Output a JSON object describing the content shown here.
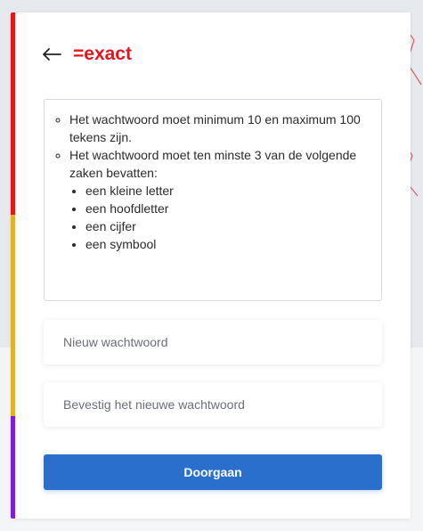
{
  "header": {
    "back_icon": "arrow-left-icon",
    "logo_text": "=exact",
    "logo_color": "#e8141c"
  },
  "rules": {
    "items": [
      "Het wachtwoord moet minimum 10 en maximum 100 tekens zijn.",
      "Het wachtwoord moet ten minste 3 van de volgende zaken bevatten:"
    ],
    "subitems": [
      "een kleine letter",
      "een hoofdletter",
      "een cijfer",
      "een symbool"
    ]
  },
  "form": {
    "new_password_placeholder": "Nieuw wachtwoord",
    "confirm_password_placeholder": "Bevestig het nieuwe wachtwoord",
    "submit_label": "Doorgaan"
  },
  "colors": {
    "stripe_red": "#e8141c",
    "stripe_yellow": "#e0b22c",
    "stripe_purple": "#7d1fd8",
    "button_blue": "#2a6fcc"
  }
}
